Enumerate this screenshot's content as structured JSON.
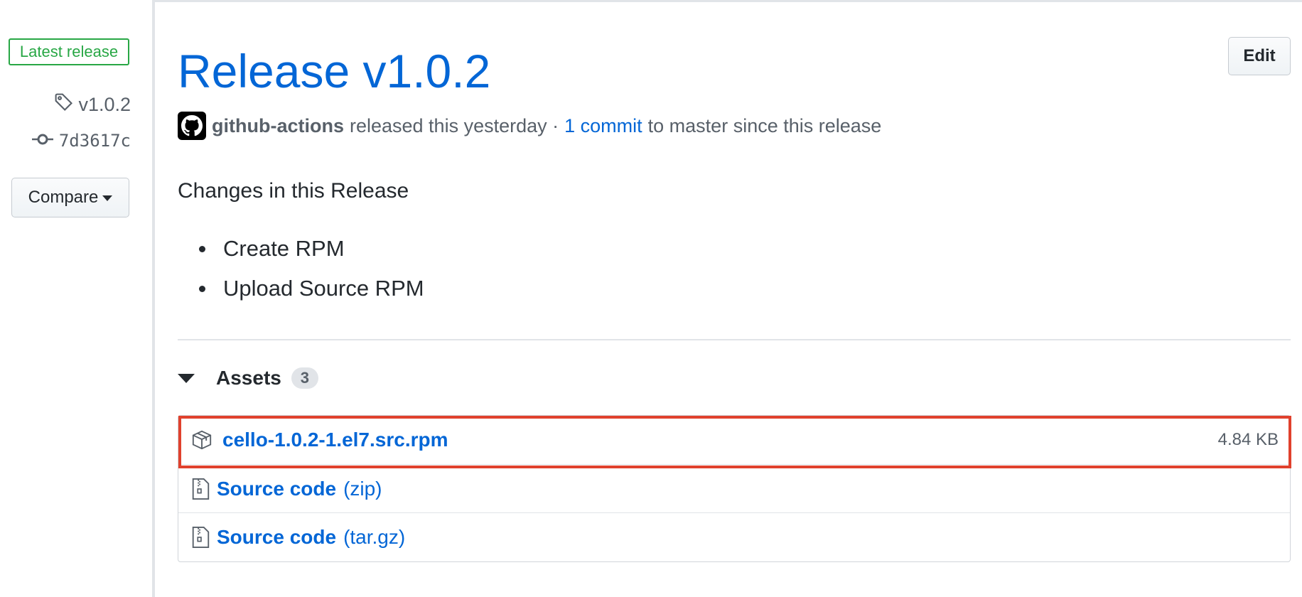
{
  "sidebar": {
    "badge_label": "Latest release",
    "tag": "v1.0.2",
    "commit": "7d3617c",
    "compare_label": "Compare"
  },
  "release": {
    "title": "Release v1.0.2",
    "author": "github-actions",
    "released_text": "released this yesterday ·",
    "commit_link": "1 commit",
    "since_text": "to master since this release",
    "edit_label": "Edit"
  },
  "notes": {
    "heading": "Changes in this Release",
    "items": [
      "Create RPM",
      "Upload Source RPM"
    ]
  },
  "assets": {
    "label": "Assets",
    "count": "3",
    "rows": [
      {
        "name": "cello-1.0.2-1.el7.src.rpm",
        "size": "4.84 KB",
        "highlighted": true
      },
      {
        "name": "Source code",
        "suffix": "(zip)"
      },
      {
        "name": "Source code",
        "suffix": "(tar.gz)"
      }
    ]
  },
  "colors": {
    "link": "#0366d6",
    "badge_green": "#28a745",
    "highlight_red": "#e0412d"
  },
  "icons": [
    "tag-icon",
    "git-commit-icon",
    "github-avatar-icon",
    "triangle-down-icon",
    "package-icon",
    "file-zip-icon"
  ]
}
